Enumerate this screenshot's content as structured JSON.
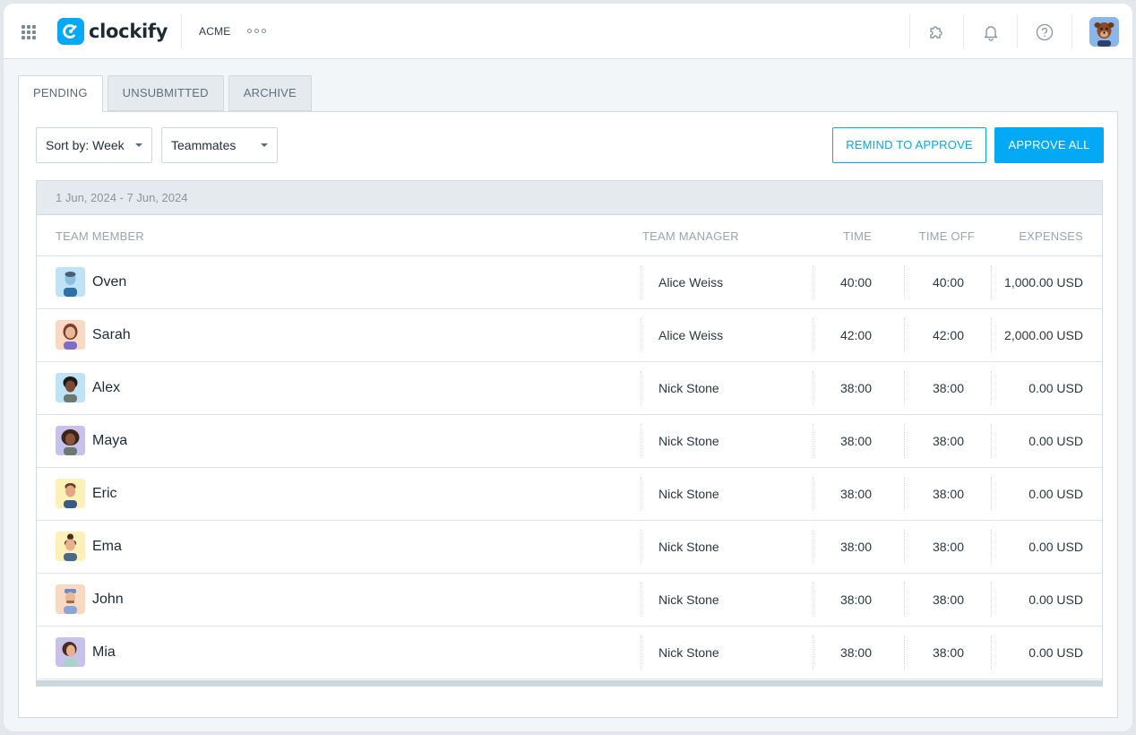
{
  "header": {
    "app_name": "clockify",
    "workspace": "ACME",
    "icons": [
      "apps-grid-icon",
      "more-icon",
      "puzzle-icon",
      "bell-icon",
      "help-icon"
    ]
  },
  "tabs": [
    {
      "label": "PENDING",
      "active": true
    },
    {
      "label": "UNSUBMITTED",
      "active": false
    },
    {
      "label": "ARCHIVE",
      "active": false
    }
  ],
  "filters": {
    "sort_label": "Sort by: Week",
    "teammates_label": "Teammates"
  },
  "actions": {
    "remind_label": "REMIND TO APPROVE",
    "approve_all_label": "APPROVE ALL"
  },
  "table": {
    "week_range": "1 Jun, 2024 - 7 Jun, 2024",
    "columns": {
      "member": "TEAM MEMBER",
      "manager": "TEAM MANAGER",
      "time": "TIME",
      "time_off": "TIME OFF",
      "expenses": "EXPENSES"
    },
    "rows": [
      {
        "name": "Oven",
        "manager": "Alice Weiss",
        "time": "40:00",
        "time_off": "40:00",
        "expenses": "1,000.00 USD",
        "avatar_bg": "#bfe3f6"
      },
      {
        "name": "Sarah",
        "manager": "Alice Weiss",
        "time": "42:00",
        "time_off": "42:00",
        "expenses": "2,000.00 USD",
        "avatar_bg": "#f9d9c2"
      },
      {
        "name": "Alex",
        "manager": "Nick Stone",
        "time": "38:00",
        "time_off": "38:00",
        "expenses": "0.00 USD",
        "avatar_bg": "#bfe3f6"
      },
      {
        "name": "Maya",
        "manager": "Nick Stone",
        "time": "38:00",
        "time_off": "38:00",
        "expenses": "0.00 USD",
        "avatar_bg": "#c7c2ec"
      },
      {
        "name": "Eric",
        "manager": "Nick Stone",
        "time": "38:00",
        "time_off": "38:00",
        "expenses": "0.00 USD",
        "avatar_bg": "#fdf0b8"
      },
      {
        "name": "Ema",
        "manager": "Nick Stone",
        "time": "38:00",
        "time_off": "38:00",
        "expenses": "0.00 USD",
        "avatar_bg": "#fdf0b8"
      },
      {
        "name": "John",
        "manager": "Nick Stone",
        "time": "38:00",
        "time_off": "38:00",
        "expenses": "0.00 USD",
        "avatar_bg": "#f9d9c2"
      },
      {
        "name": "Mia",
        "manager": "Nick Stone",
        "time": "38:00",
        "time_off": "38:00",
        "expenses": "0.00 USD",
        "avatar_bg": "#c7c2ec"
      }
    ]
  },
  "colors": {
    "accent": "#03a9f4",
    "background": "#f2f6f8",
    "header_band": "#e5eaee"
  }
}
